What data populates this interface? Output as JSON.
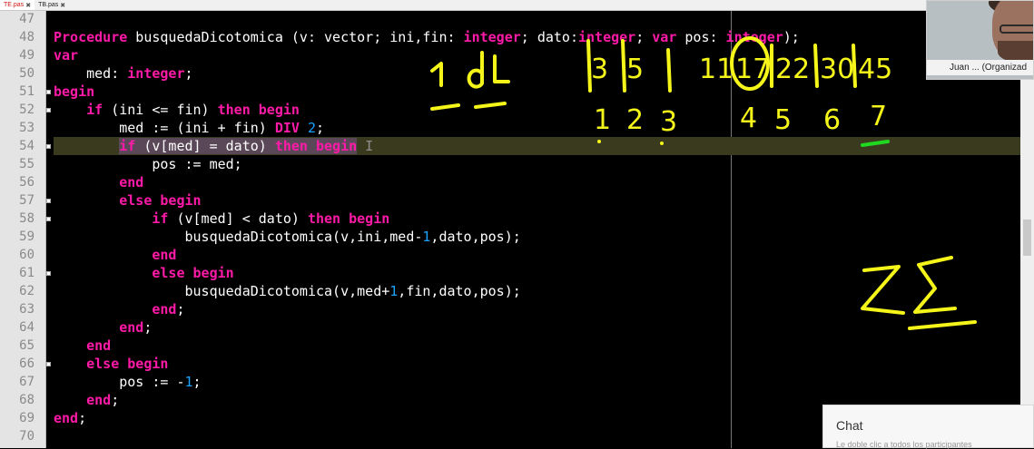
{
  "tabs": [
    {
      "label": "TE.pas",
      "active": true
    },
    {
      "label": "TB.pas",
      "active": false
    }
  ],
  "editor": {
    "current_line": 54,
    "lines": [
      {
        "n": "47",
        "fold": false,
        "tokens": []
      },
      {
        "n": "48",
        "fold": false,
        "tokens": [
          [
            "kw",
            "Procedure"
          ],
          [
            "t",
            " busquedaDicotomica (v: vector; ini,fin: "
          ],
          [
            "kw",
            "integer"
          ],
          [
            "t",
            "; dato:"
          ],
          [
            "kw",
            "integer"
          ],
          [
            "t",
            "; "
          ],
          [
            "kw",
            "var"
          ],
          [
            "t",
            " pos: "
          ],
          [
            "kw",
            "integer"
          ],
          [
            "t",
            ");"
          ]
        ]
      },
      {
        "n": "49",
        "fold": false,
        "tokens": [
          [
            "kw",
            "var"
          ]
        ]
      },
      {
        "n": "50",
        "fold": false,
        "tokens": [
          [
            "t",
            "    med: "
          ],
          [
            "kw",
            "integer"
          ],
          [
            "t",
            ";"
          ]
        ]
      },
      {
        "n": "51",
        "fold": true,
        "tokens": [
          [
            "kw",
            "begin"
          ]
        ]
      },
      {
        "n": "52",
        "fold": true,
        "tokens": [
          [
            "t",
            "    "
          ],
          [
            "kw",
            "if"
          ],
          [
            "t",
            " (ini <= fin) "
          ],
          [
            "kw",
            "then begin"
          ]
        ]
      },
      {
        "n": "53",
        "fold": false,
        "tokens": [
          [
            "t",
            "        med := (ini + fin) "
          ],
          [
            "kw",
            "DIV"
          ],
          [
            "t",
            " "
          ],
          [
            "num",
            "2"
          ],
          [
            "t",
            ";"
          ]
        ]
      },
      {
        "n": "54",
        "fold": true,
        "tokens": [
          [
            "t",
            "        "
          ],
          [
            "sel_kw",
            "if"
          ],
          [
            "sel",
            " (v[med] = dato) "
          ],
          [
            "sel_kw",
            "then begin"
          ],
          [
            "cur",
            " I"
          ]
        ]
      },
      {
        "n": "55",
        "fold": false,
        "tokens": [
          [
            "t",
            "            pos := med;"
          ]
        ]
      },
      {
        "n": "56",
        "fold": false,
        "tokens": [
          [
            "t",
            "        "
          ],
          [
            "kw",
            "end"
          ]
        ]
      },
      {
        "n": "57",
        "fold": true,
        "tokens": [
          [
            "t",
            "        "
          ],
          [
            "kw",
            "else begin"
          ]
        ]
      },
      {
        "n": "58",
        "fold": true,
        "tokens": [
          [
            "t",
            "            "
          ],
          [
            "kw",
            "if"
          ],
          [
            "t",
            " (v[med] < dato) "
          ],
          [
            "kw",
            "then begin"
          ]
        ]
      },
      {
        "n": "59",
        "fold": false,
        "tokens": [
          [
            "t",
            "                busquedaDicotomica(v,ini,med-"
          ],
          [
            "num",
            "1"
          ],
          [
            "t",
            ",dato,pos);"
          ]
        ]
      },
      {
        "n": "60",
        "fold": false,
        "tokens": [
          [
            "t",
            "            "
          ],
          [
            "kw",
            "end"
          ]
        ]
      },
      {
        "n": "61",
        "fold": true,
        "tokens": [
          [
            "t",
            "            "
          ],
          [
            "kw",
            "else begin"
          ]
        ]
      },
      {
        "n": "62",
        "fold": false,
        "tokens": [
          [
            "t",
            "                busquedaDicotomica(v,med+"
          ],
          [
            "num",
            "1"
          ],
          [
            "t",
            ",fin,dato,pos);"
          ]
        ]
      },
      {
        "n": "63",
        "fold": false,
        "tokens": [
          [
            "t",
            "            "
          ],
          [
            "kw",
            "end"
          ],
          [
            "t",
            ";"
          ]
        ]
      },
      {
        "n": "64",
        "fold": false,
        "tokens": [
          [
            "t",
            "        "
          ],
          [
            "kw",
            "end"
          ],
          [
            "t",
            ";"
          ]
        ]
      },
      {
        "n": "65",
        "fold": false,
        "tokens": [
          [
            "t",
            "    "
          ],
          [
            "kw",
            "end"
          ]
        ]
      },
      {
        "n": "66",
        "fold": true,
        "tokens": [
          [
            "t",
            "    "
          ],
          [
            "kw",
            "else begin"
          ]
        ]
      },
      {
        "n": "67",
        "fold": false,
        "tokens": [
          [
            "t",
            "        pos := -"
          ],
          [
            "num",
            "1"
          ],
          [
            "t",
            ";"
          ]
        ]
      },
      {
        "n": "68",
        "fold": false,
        "tokens": [
          [
            "t",
            "    "
          ],
          [
            "kw",
            "end"
          ],
          [
            "t",
            ";"
          ]
        ]
      },
      {
        "n": "69",
        "fold": false,
        "tokens": [
          [
            "kw",
            "end"
          ],
          [
            "t",
            ";"
          ]
        ]
      },
      {
        "n": "70",
        "fold": false,
        "tokens": []
      }
    ]
  },
  "annotations": {
    "top_left": [
      "1",
      "dL"
    ],
    "array_values": [
      "3",
      "5",
      "11",
      "17",
      "22",
      "30",
      "45"
    ],
    "indices": [
      "1",
      "2",
      "3",
      "4",
      "5",
      "6",
      "7"
    ],
    "circled_value": "17",
    "sum_note": "2Σ",
    "ink_colors": {
      "main": "#f5f51a",
      "highlight": "#1fd81f"
    }
  },
  "webcam": {
    "label": "Juan ... (Organizad"
  },
  "chat": {
    "title": "Chat",
    "subtitle": "Le doble clic a todos los participantes"
  }
}
